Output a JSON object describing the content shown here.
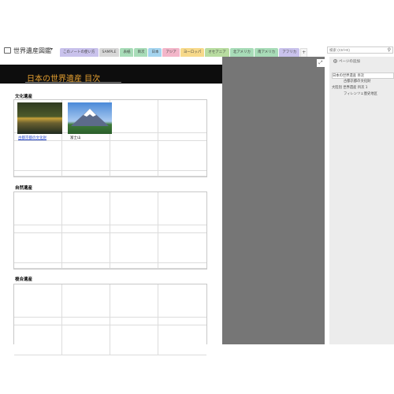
{
  "notebook": {
    "title": "世界遺産図鑑"
  },
  "tabs": [
    {
      "label": "このノートの使い方",
      "color": "#c9c2ec"
    },
    {
      "label": "SAMPLE",
      "color": "#d7d7d7"
    },
    {
      "label": "表紙",
      "color": "#a8dcb8"
    },
    {
      "label": "目次",
      "color": "#a8dcb8"
    },
    {
      "label": "日本",
      "color": "#a4d4ef"
    },
    {
      "label": "アジア",
      "color": "#f3b6c9"
    },
    {
      "label": "ヨーロッパ",
      "color": "#f7d98a"
    },
    {
      "label": "オセアニア",
      "color": "#b8dca0"
    },
    {
      "label": "北アメリカ",
      "color": "#a8dcb8"
    },
    {
      "label": "南アメリカ",
      "color": "#a8dcb8"
    },
    {
      "label": "アフリカ",
      "color": "#c9c2ec"
    }
  ],
  "add_tab": "+",
  "search": {
    "placeholder": "検索 (Ctrl+E)"
  },
  "page": {
    "banner_title": "日本の世界遺産 目次",
    "sections": [
      {
        "title": "文化遺産"
      },
      {
        "title": "自然遺産"
      },
      {
        "title": "複合遺産"
      }
    ],
    "captions": [
      "古都京都の文化財",
      "富士山"
    ]
  },
  "sidebar": {
    "add_page": "ページの追加",
    "pages": [
      {
        "label": "日本の世界遺産 目次",
        "selected": true,
        "sub": false
      },
      {
        "label": "古都京都の文化財",
        "selected": false,
        "sub": true
      },
      {
        "label": "大陸別 世界遺産 目次 1",
        "selected": false,
        "sub": false
      },
      {
        "label": "フィレンツェ歴史地区",
        "selected": false,
        "sub": true
      }
    ]
  }
}
